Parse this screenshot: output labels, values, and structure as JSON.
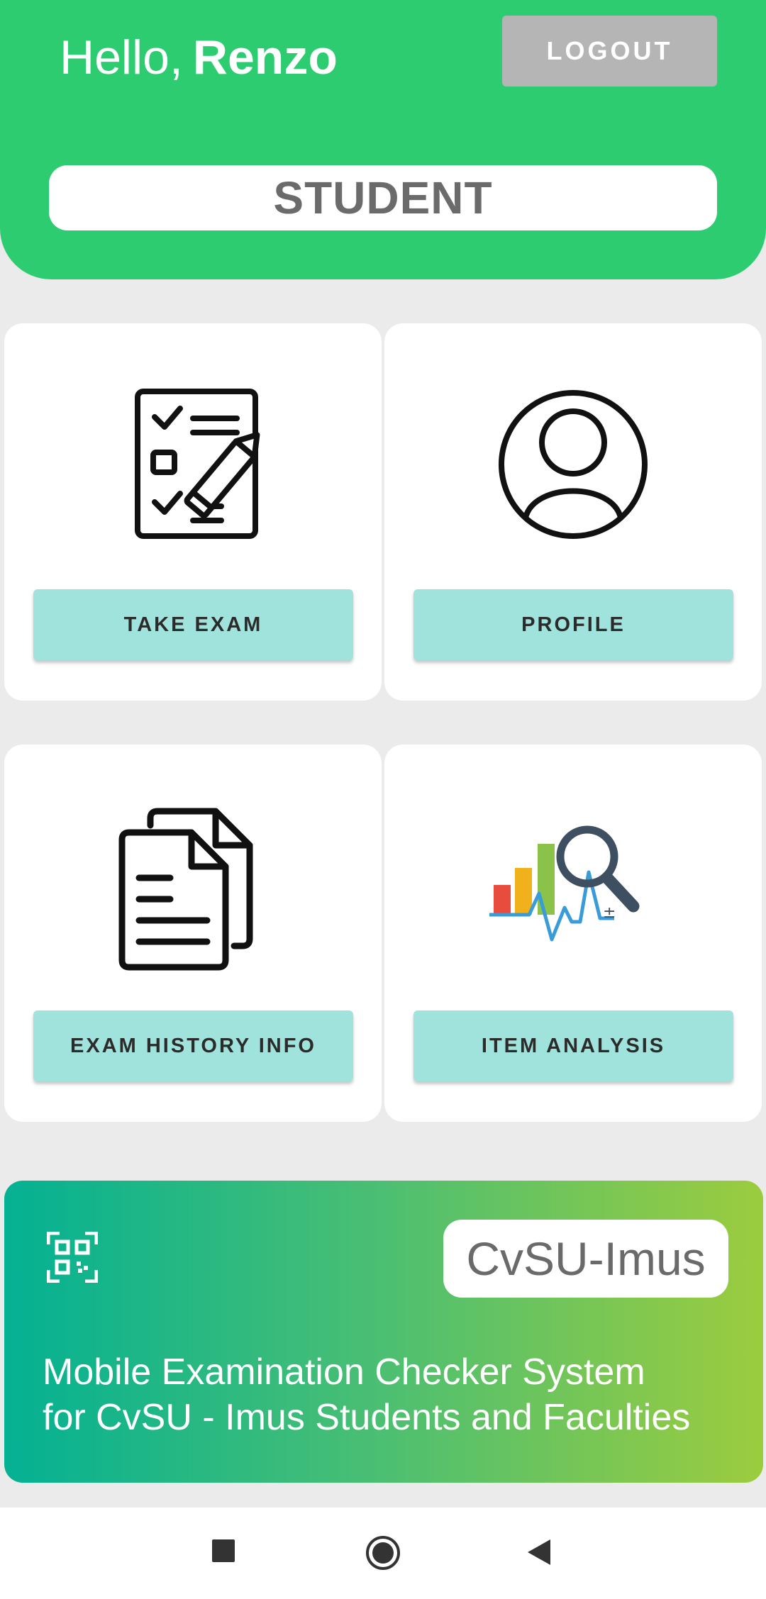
{
  "header": {
    "greeting": "Hello,",
    "user_name": "Renzo",
    "logout_label": "LOGOUT",
    "role": "STUDENT",
    "background_color": "#2ecc71"
  },
  "cards": [
    {
      "icon": "exam-checklist-icon",
      "button_label": "TAKE EXAM"
    },
    {
      "icon": "user-profile-icon",
      "button_label": "PROFILE"
    },
    {
      "icon": "documents-icon",
      "button_label": "EXAM HISTORY INFO"
    },
    {
      "icon": "analytics-magnifier-icon",
      "button_label": "ITEM ANALYSIS"
    }
  ],
  "banner": {
    "icon": "qr-code-icon",
    "brand": "CvSU-Imus",
    "description_line1": "Mobile Examination Checker System",
    "description_line2": "for CvSU - Imus Students and Faculties",
    "gradient_start": "#03b193",
    "gradient_end": "#9ccc3e"
  },
  "navbar": {
    "items": [
      "recents-icon",
      "home-icon",
      "back-icon"
    ]
  },
  "colors": {
    "card_button": "#a0e3dc",
    "logout_button": "#b5b5b5",
    "page_background": "#ebebeb"
  }
}
